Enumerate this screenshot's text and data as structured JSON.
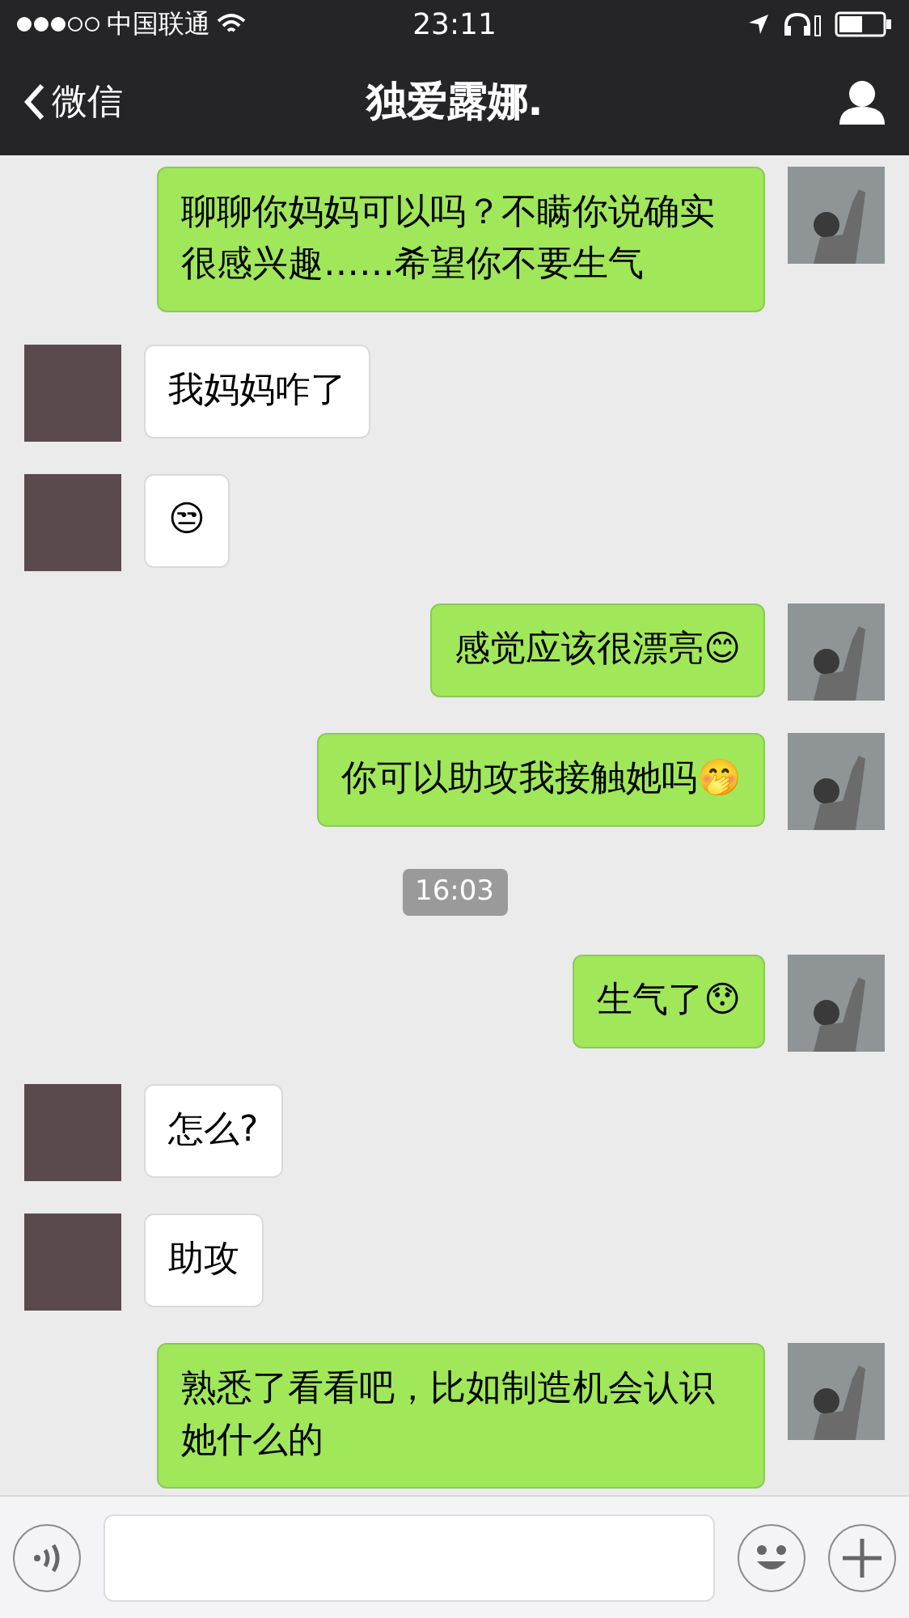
{
  "status_bar": {
    "carrier": "中国联通",
    "time": "23:11"
  },
  "nav": {
    "back": "微信",
    "title": "独爱露娜."
  },
  "messages": [
    {
      "kind": "text",
      "outgoing": true,
      "text": "聊聊你妈妈可以吗？不瞒你说确实很感兴趣……希望你不要生气"
    },
    {
      "kind": "text",
      "outgoing": false,
      "text": "我妈妈咋了"
    },
    {
      "kind": "text",
      "outgoing": false,
      "text": "😒"
    },
    {
      "kind": "text",
      "outgoing": true,
      "text": "感觉应该很漂亮😊"
    },
    {
      "kind": "text",
      "outgoing": true,
      "text": "你可以助攻我接触她吗🤭"
    },
    {
      "kind": "time",
      "text": "16:03"
    },
    {
      "kind": "text",
      "outgoing": true,
      "text": "生气了😯"
    },
    {
      "kind": "text",
      "outgoing": false,
      "text": "怎么?"
    },
    {
      "kind": "text",
      "outgoing": false,
      "text": "助攻"
    },
    {
      "kind": "text",
      "outgoing": true,
      "text": "熟悉了看看吧，比如制造机会认识她什么的"
    }
  ]
}
